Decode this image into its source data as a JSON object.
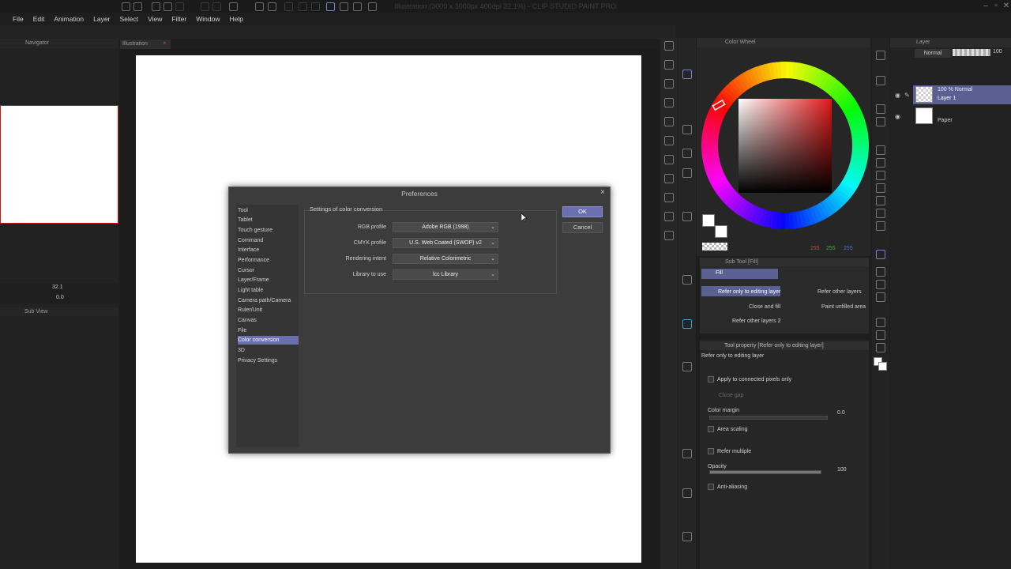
{
  "app": {
    "title": "Illustration (3000 x 3000px 400dpi 32.1%) - CLIP STUDIO PAINT PRO"
  },
  "menu": [
    "File",
    "Edit",
    "Animation",
    "Layer",
    "Select",
    "View",
    "Filter",
    "Window",
    "Help"
  ],
  "navigator": {
    "tab_label": "Navigator",
    "zoom": "32.1",
    "rotation": "0.0",
    "subview_label": "Sub View"
  },
  "document": {
    "tab_label": "Illustration"
  },
  "preferences": {
    "title": "Preferences",
    "categories": [
      "Tool",
      "Tablet",
      "Touch gesture",
      "Command",
      "Interface",
      "Performance",
      "Cursor",
      "Layer/Frame",
      "Light table",
      "Camera path/Camera",
      "Ruler/Unit",
      "Canvas",
      "File",
      "Color conversion",
      "3D",
      "Privacy Settings"
    ],
    "selected_category": "Color conversion",
    "group_label": "Settings of color conversion",
    "fields": [
      {
        "label": "RGB profile",
        "value": "Adobe RGB (1998)"
      },
      {
        "label": "CMYK profile",
        "value": "U.S. Web Coated (SWOP) v2"
      },
      {
        "label": "Rendering intent",
        "value": "Relative Colorimetric"
      },
      {
        "label": "Library to use",
        "value": "lcc Library"
      }
    ],
    "ok_label": "OK",
    "cancel_label": "Cancel"
  },
  "color_wheel": {
    "tab_label": "Color Wheel",
    "r": "255",
    "g": "255",
    "b": "255"
  },
  "sub_tool": {
    "tab_label": "Sub Tool [Fill]",
    "group": "Fill",
    "items": [
      "Refer only to editing layer",
      "Refer other layers",
      "Close and fill",
      "Paint unfilled area",
      "Refer other layers 2"
    ]
  },
  "tool_property": {
    "tab_label": "Tool property [Refer only to editing layer]",
    "subtitle": "Refer only to editing layer",
    "connected": "Apply to connected pixels only",
    "close_gap": "Close gap",
    "color_margin": "Color margin",
    "color_margin_val": "0.0",
    "area_scaling": "Area scaling",
    "refer_multiple": "Refer multiple",
    "opacity": "Opacity",
    "opacity_val": "100",
    "antialiasing": "Anti-aliasing"
  },
  "layer": {
    "tab_label": "Layer",
    "blend": "Normal",
    "opacity": "100",
    "layer1_mode": "100 % Normal",
    "layer1_name": "Layer 1",
    "paper_name": "Paper"
  },
  "colors": {
    "accent": "#6a6fb0",
    "canvas": "#ffffff"
  }
}
